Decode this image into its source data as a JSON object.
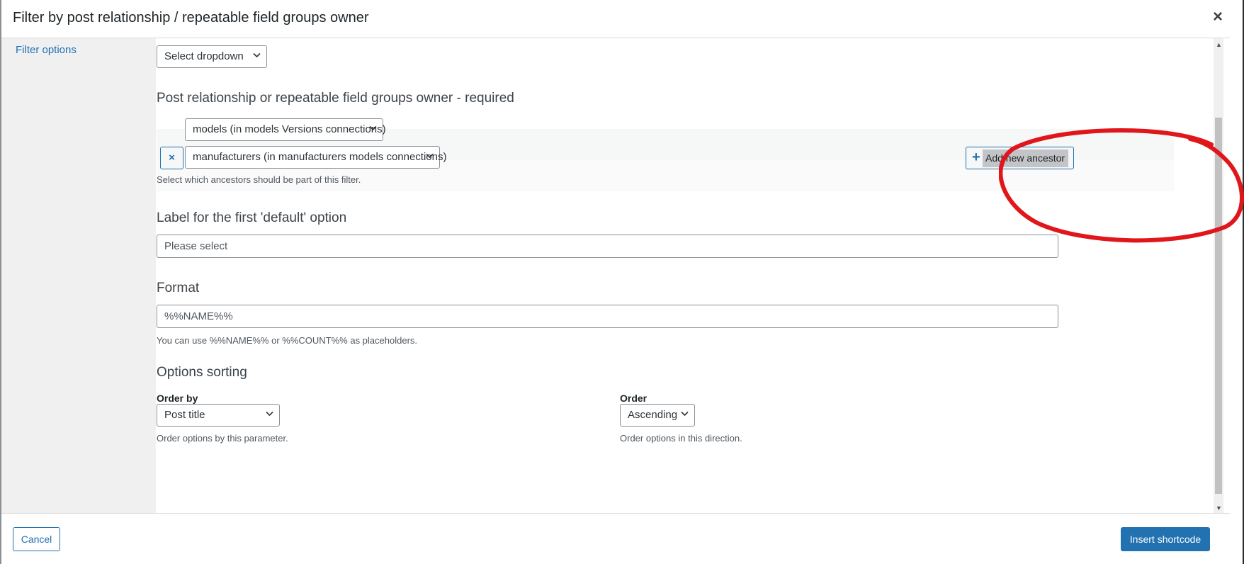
{
  "modal": {
    "title": "Filter by post relationship / repeatable field groups owner",
    "close_glyph": "×"
  },
  "sidebar": {
    "link_label": "Filter options"
  },
  "type_select": {
    "value": "Select dropdown"
  },
  "ancestors": {
    "heading": "Post relationship or repeatable field groups owner - required",
    "first_value": "models (in models Versions connections)",
    "second_value": "manufacturers (in manufacturers models connections)",
    "remove_glyph": "×",
    "add_plus": "+",
    "add_label": "Add new ancestor",
    "helper": "Select which ancestors should be part of this filter."
  },
  "default_label": {
    "heading": "Label for the first 'default' option",
    "value": "Please select"
  },
  "format": {
    "heading": "Format",
    "value": "%%NAME%%",
    "helper": "You can use %%NAME%% or %%COUNT%% as placeholders."
  },
  "sorting": {
    "heading": "Options sorting",
    "order_by_label": "Order by",
    "order_by_value": "Post title",
    "order_by_helper": "Order options by this parameter.",
    "order_label": "Order",
    "order_value": "Ascending",
    "order_helper": "Order options in this direction."
  },
  "footer": {
    "cancel_label": "Cancel",
    "insert_label": "Insert shortcode"
  },
  "colors": {
    "accent": "#2271b1",
    "annotation": "#e0161b"
  }
}
